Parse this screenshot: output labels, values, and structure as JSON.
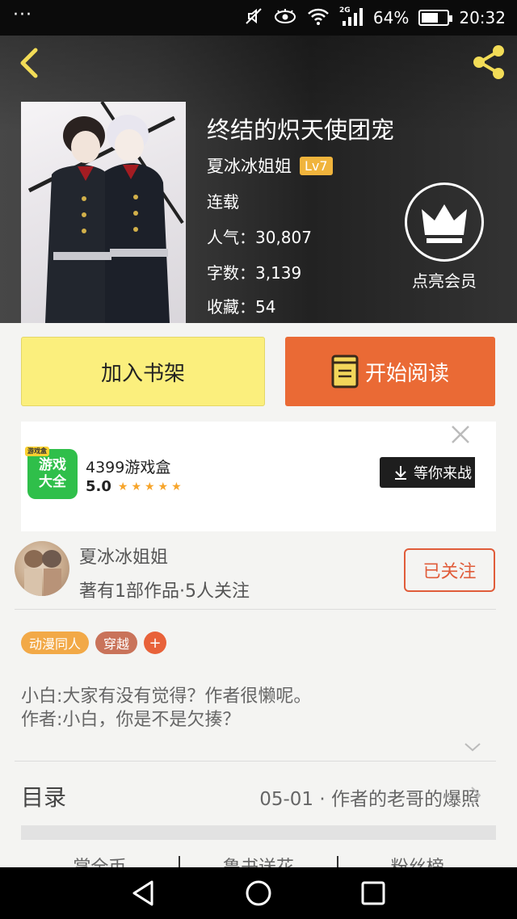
{
  "status_bar": {
    "dots": "···",
    "signal_label": "2G",
    "battery_percent": "64%",
    "battery_level": 0.64,
    "time": "20:32"
  },
  "header": {
    "back_icon": "chevron-left-icon",
    "share_icon": "share-icon",
    "book_title": "终结的炽天使团宠",
    "author": "夏冰冰姐姐",
    "level": "Lv7",
    "status": "连载",
    "popularity": "人气：30,807",
    "word_count": "字数：3,139",
    "favorites": "收藏：54",
    "vip_icon": "crown-icon",
    "vip_label": "点亮会员"
  },
  "actions": {
    "add_to_shelf": "加入书架",
    "start_reading": "开始阅读",
    "read_icon": "book-icon"
  },
  "ad": {
    "logo_tag": "游戏盒",
    "logo_text_1": "游戏",
    "logo_text_2": "大全",
    "app_name": "4399游戏盒",
    "rating": "5.0",
    "stars": "★★★★★",
    "cta": "等你来战",
    "close_icon": "close-icon"
  },
  "author_card": {
    "name": "夏冰冰姐姐",
    "info": "著有1部作品·5人关注",
    "follow_label": "已关注"
  },
  "tags": [
    {
      "label": "动漫同人",
      "color": "#f2a947"
    },
    {
      "label": "穿越",
      "color": "#c9735a"
    }
  ],
  "tag_add": "+",
  "summary": {
    "line1": "小白:大家有没有觉得？作者很懒呢。",
    "line2": "作者:小白，你是不是欠揍？"
  },
  "toc": {
    "label": "目录",
    "latest_chapter": "05-01 · 作者的老哥的爆照"
  },
  "bottom_tabs": [
    "掌全币",
    "鲁书送花",
    "粉丝榜"
  ],
  "nav": {
    "back": "back-triangle-icon",
    "home": "home-circle-icon",
    "recents": "recents-square-icon"
  },
  "colors": {
    "accent_orange": "#ea6a35",
    "shelf_yellow": "#fbef7d",
    "follow_red": "#e05c3a",
    "level_badge": "#f0b43c"
  }
}
